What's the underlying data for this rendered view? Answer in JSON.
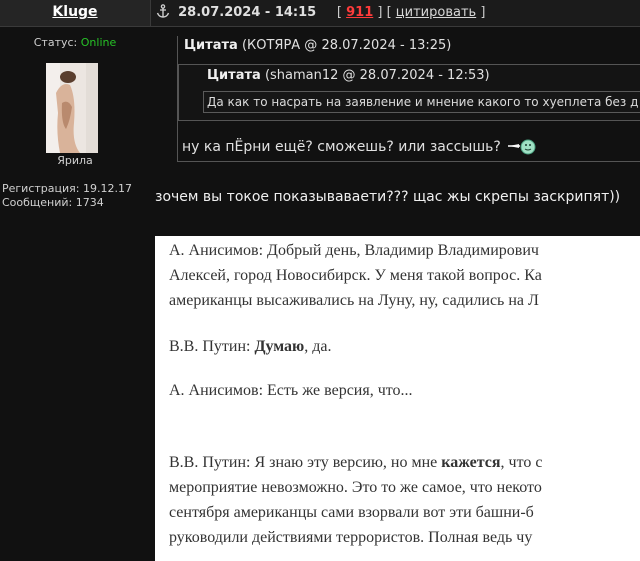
{
  "header": {
    "username": "Kluge",
    "datetime": "28.07.2024 - 14:15",
    "rating": "911",
    "quote_action": "цитировать",
    "anchor_icon": "anchor-icon"
  },
  "author": {
    "status_label": "Статус:",
    "status_value": "Online",
    "status_color": "#27c227",
    "rank": "Ярила",
    "registration": "Регистрация: 19.12.17",
    "messages": "Сообщений: 1734"
  },
  "quote_outer": {
    "label": "Цитата",
    "meta": "(КОТЯРА @ 28.07.2024 - 13:25)",
    "reply": "ну ка пЁрни ещё? сможешь? или зассышь?"
  },
  "quote_inner": {
    "label": "Цитата",
    "meta": "(shaman12 @ 28.07.2024 - 12:53)",
    "text": "Да как то насрать на заявление и мнение какого то хуеплета без д"
  },
  "post": {
    "text": "зочем вы токое показываваети??? щас жы скрепы заскрипят))"
  },
  "document": {
    "line1": "А. Анисимов: Добрый день, Владимир Владимирович",
    "line2": "Алексей, город Новосибирск. У меня такой вопрос. Ка",
    "line3": "американцы высаживались на Луну, ну, садились на Л",
    "line4_prefix": "В.В. Путин: ",
    "line4_bold": "Думаю",
    "line4_suffix": ", да.",
    "line5": "А. Анисимов: Есть же версия, что...",
    "line6_prefix": "В.В. Путин: Я знаю эту версию, но мне ",
    "line6_bold": "кажется",
    "line6_suffix": ", что с",
    "line7": "мероприятие невозможно. Это то же самое, что некото",
    "line8": "сентября американцы сами взорвали вот эти башни-б",
    "line9": "руководили действиями террористов. Полная ведь чу"
  }
}
